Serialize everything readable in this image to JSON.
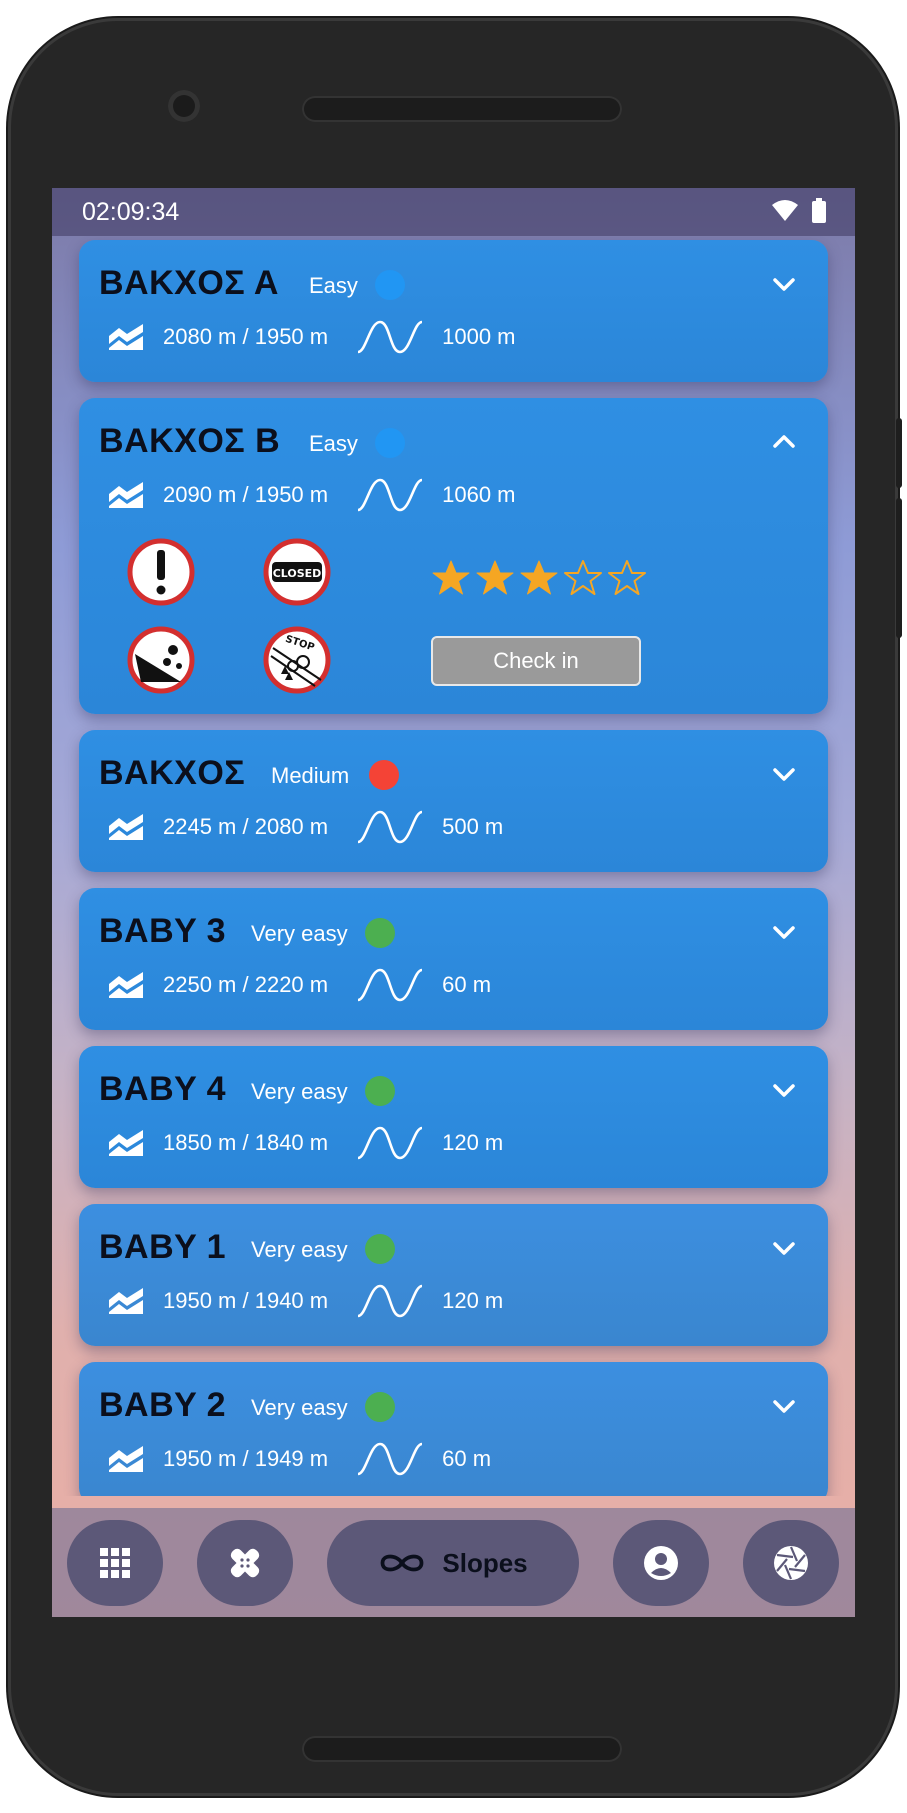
{
  "status_bar": {
    "time": "02:09:34",
    "icons": [
      "wifi-icon",
      "battery-icon"
    ]
  },
  "colors": {
    "card": "#2f8fe3",
    "easy": "#2196f3",
    "medium": "#f44336",
    "very_easy": "#4caf50",
    "star": "#f5a623",
    "checkin_button": "#9a9a9a"
  },
  "slopes": [
    {
      "name": "ΒΑΚΧΟΣ Α",
      "difficulty": "Easy",
      "difficulty_color": "#2196f3",
      "altitude": "2080 m / 1950 m",
      "length": "1000 m",
      "expanded": false
    },
    {
      "name": "ΒΑΚΧΟΣ Β",
      "difficulty": "Easy",
      "difficulty_color": "#2196f3",
      "altitude": "2090 m / 1950 m",
      "length": "1060 m",
      "expanded": true,
      "signs": [
        "warning-sign-icon",
        "closed-sign-icon",
        "falling-rocks-sign-icon",
        "stop-avalanche-sign-icon"
      ],
      "signs_text": {
        "closed": "CLOSED",
        "stop": "STOP"
      },
      "rating": 3,
      "rating_max": 5,
      "checkin_label": "Check in"
    },
    {
      "name": "ΒΑΚΧΟΣ",
      "difficulty": "Medium",
      "difficulty_color": "#f44336",
      "altitude": "2245 m / 2080 m",
      "length": "500 m",
      "expanded": false
    },
    {
      "name": "BABY 3",
      "difficulty": "Very easy",
      "difficulty_color": "#4caf50",
      "altitude": "2250 m / 2220 m",
      "length": "60 m",
      "expanded": false
    },
    {
      "name": "BABY 4",
      "difficulty": "Very easy",
      "difficulty_color": "#4caf50",
      "altitude": "1850 m / 1840 m",
      "length": "120 m",
      "expanded": false
    },
    {
      "name": "BABY 1",
      "difficulty": "Very easy",
      "difficulty_color": "#4caf50",
      "altitude": "1950 m / 1940 m",
      "length": "120 m",
      "expanded": false
    },
    {
      "name": "BABY 2",
      "difficulty": "Very easy",
      "difficulty_color": "#4caf50",
      "altitude": "1950 m / 1949 m",
      "length": "60 m",
      "expanded": false
    }
  ],
  "nav": {
    "items": [
      {
        "icon": "grid-icon"
      },
      {
        "icon": "bandage-icon"
      },
      {
        "icon": "infinity-icon",
        "label": "Slopes",
        "active": true
      },
      {
        "icon": "account-icon"
      },
      {
        "icon": "camera-shutter-icon"
      }
    ]
  }
}
